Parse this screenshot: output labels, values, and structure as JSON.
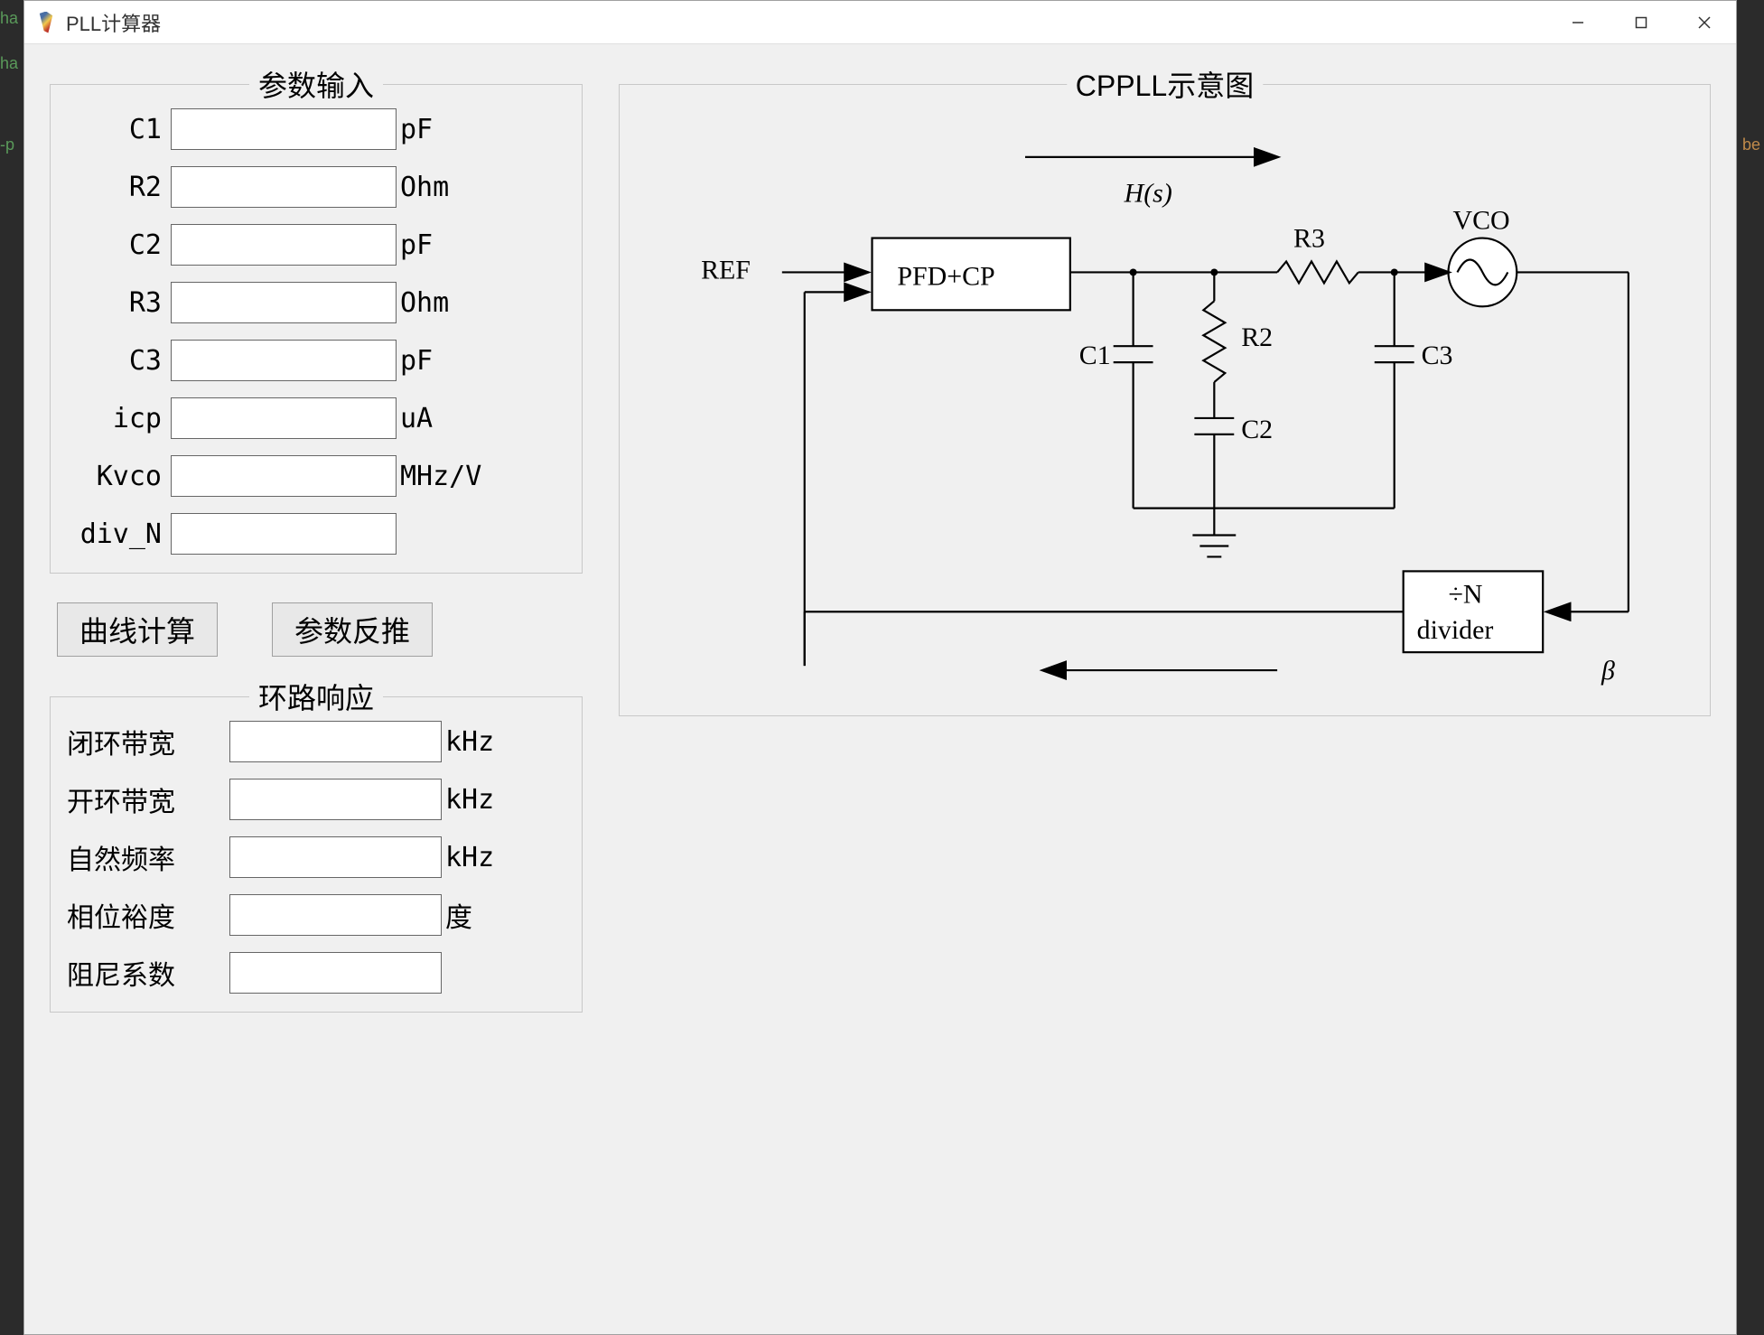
{
  "window": {
    "title": "PLL计算器"
  },
  "params": {
    "title": "参数输入",
    "fields": [
      {
        "label": "C1",
        "value": "",
        "unit": "pF"
      },
      {
        "label": "R2",
        "value": "",
        "unit": "Ohm"
      },
      {
        "label": "C2",
        "value": "",
        "unit": "pF"
      },
      {
        "label": "R3",
        "value": "",
        "unit": "Ohm"
      },
      {
        "label": "C3",
        "value": "",
        "unit": "pF"
      },
      {
        "label": "icp",
        "value": "",
        "unit": "uA"
      },
      {
        "label": "Kvco",
        "value": "",
        "unit": "MHz/V"
      },
      {
        "label": "div_N",
        "value": "",
        "unit": ""
      }
    ]
  },
  "buttons": {
    "calc": "曲线计算",
    "back": "参数反推"
  },
  "response": {
    "title": "环路响应",
    "fields": [
      {
        "label": "闭环带宽",
        "value": "",
        "unit": "kHz"
      },
      {
        "label": "开环带宽",
        "value": "",
        "unit": "kHz"
      },
      {
        "label": "自然频率",
        "value": "",
        "unit": "kHz"
      },
      {
        "label": "相位裕度",
        "value": "",
        "unit": "度"
      },
      {
        "label": "阻尼系数",
        "value": "",
        "unit": ""
      }
    ]
  },
  "diagram": {
    "title": "CPPLL示意图",
    "labels": {
      "ref": "REF",
      "pfdcp": "PFD+CP",
      "c1": "C1",
      "r2": "R2",
      "c2": "C2",
      "r3": "R3",
      "c3": "C3",
      "vco": "VCO",
      "div_top": "÷N",
      "div_bot": "divider",
      "hs": "H(s)",
      "beta": "β"
    }
  }
}
